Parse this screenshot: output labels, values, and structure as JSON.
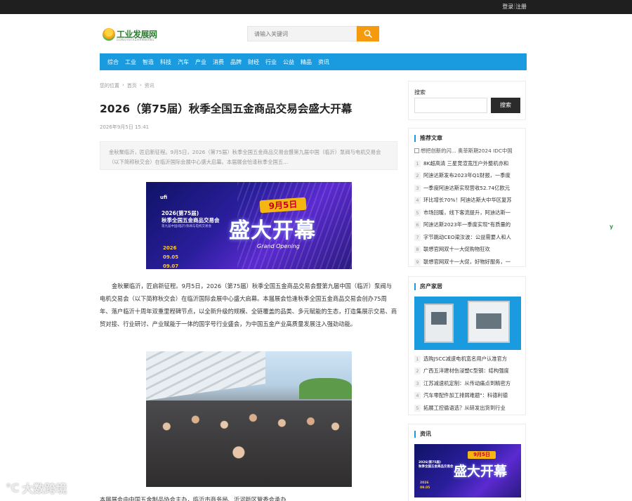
{
  "topbar": {
    "login": "登录",
    "register": "注册"
  },
  "logo": {
    "text": "工业发展网",
    "sub": "GONGYEFAZHANWANG"
  },
  "search": {
    "placeholder": "请输入关键词"
  },
  "nav": [
    "综合",
    "工业",
    "智造",
    "科技",
    "汽车",
    "产业",
    "消费",
    "品牌",
    "财经",
    "行业",
    "公益",
    "精品",
    "资讯"
  ],
  "breadcrumb": {
    "label": "您的位置",
    "home": "首页",
    "section": "资讯",
    "sep": "›"
  },
  "article": {
    "title": "2026（第75届）秋季全国五金商品交易会盛大开幕",
    "date": "2026年9月5日 15:41",
    "summary": "金秋聚临沂，匠启新征程。9月5日，2026（第75届）秋季全国五金商品交易会暨第九届中国（临沂）泵阀与电机交易会（以下简称秋交会）在临沂国际会展中心盛大启幕。本届展会恰逢秋季全国五…",
    "paragraph": "金秋聚临沂，匠启新征程。9月5日，2026（第75届）秋季全国五金商品交易会暨第九届中国（临沂）泵阀与电机交易会（以下简称秋交会）在临沂国际会展中心盛大启幕。本届展会恰逢秋季全国五金商品交易会创办75周年、落户临沂十周年双重里程碑节点，以全新升级的规模、全链覆盖的品类、多元赋能的生态，打造集展示交易、商贸对接、行业研讨、产业赋能于一体的国字号行业盛会，为中国五金产业高质量发展注入强劲动能。",
    "paragraph2": "本届展会由中国五金制品协会主办，临沂市商务局、沂河新区管委会承办……",
    "banner": {
      "ufi": "ufi",
      "line1": "2026(第75届)",
      "line2": "秋季全国五金商品交易会",
      "line3": "第九届中国(临沂)泵阀与电机交易会",
      "date_year": "2026",
      "date_start": "09.05",
      "date_end": "09.07",
      "ribbon": "9月5日",
      "headline": "盛大开幕",
      "subline": "Grand Opening"
    }
  },
  "sidebar": {
    "search_label": "搜索",
    "search_button": "搜索",
    "recommended": {
      "title": "推荐文章",
      "broken_image_text": "想把创新的闪... 奥菲斯期2024 IDC中国",
      "items": [
        "8K超高清 三星竞渲宽压户外整机亦和",
        "阿迪达斯发布2023年Q1财报，一季度",
        "一季度阿迪达斯实现营收52.74亿欧元",
        "环比增长70%！阿迪达斯大中华区复苏",
        "市场回暖，线下客流提升，阿迪达斯一",
        "阿迪达斯2023年一季度实现\"有质量的",
        "字节跳动CEO梁汝波：公益需要人和人",
        "联想官网双十一大促购物狂欢",
        "联想官网双十一大促，好物好服务，一"
      ]
    },
    "house": {
      "title": "房产家居",
      "items": [
        "选购JSCC减速电机宽名用户认准官方",
        "广西五洋建材伤浸塑C型钢：结构强度",
        "江苏减速机定制：从传动痛点到精密方",
        "汽车零配件加工排屑难题\"：科德利德",
        "拓展工控循语选？从研发出货到行业"
      ]
    },
    "news": {
      "title": "资讯"
    }
  },
  "watermark": {
    "mark": "℃",
    "text": "大数跨境"
  },
  "float": {
    "glyph": "y"
  }
}
